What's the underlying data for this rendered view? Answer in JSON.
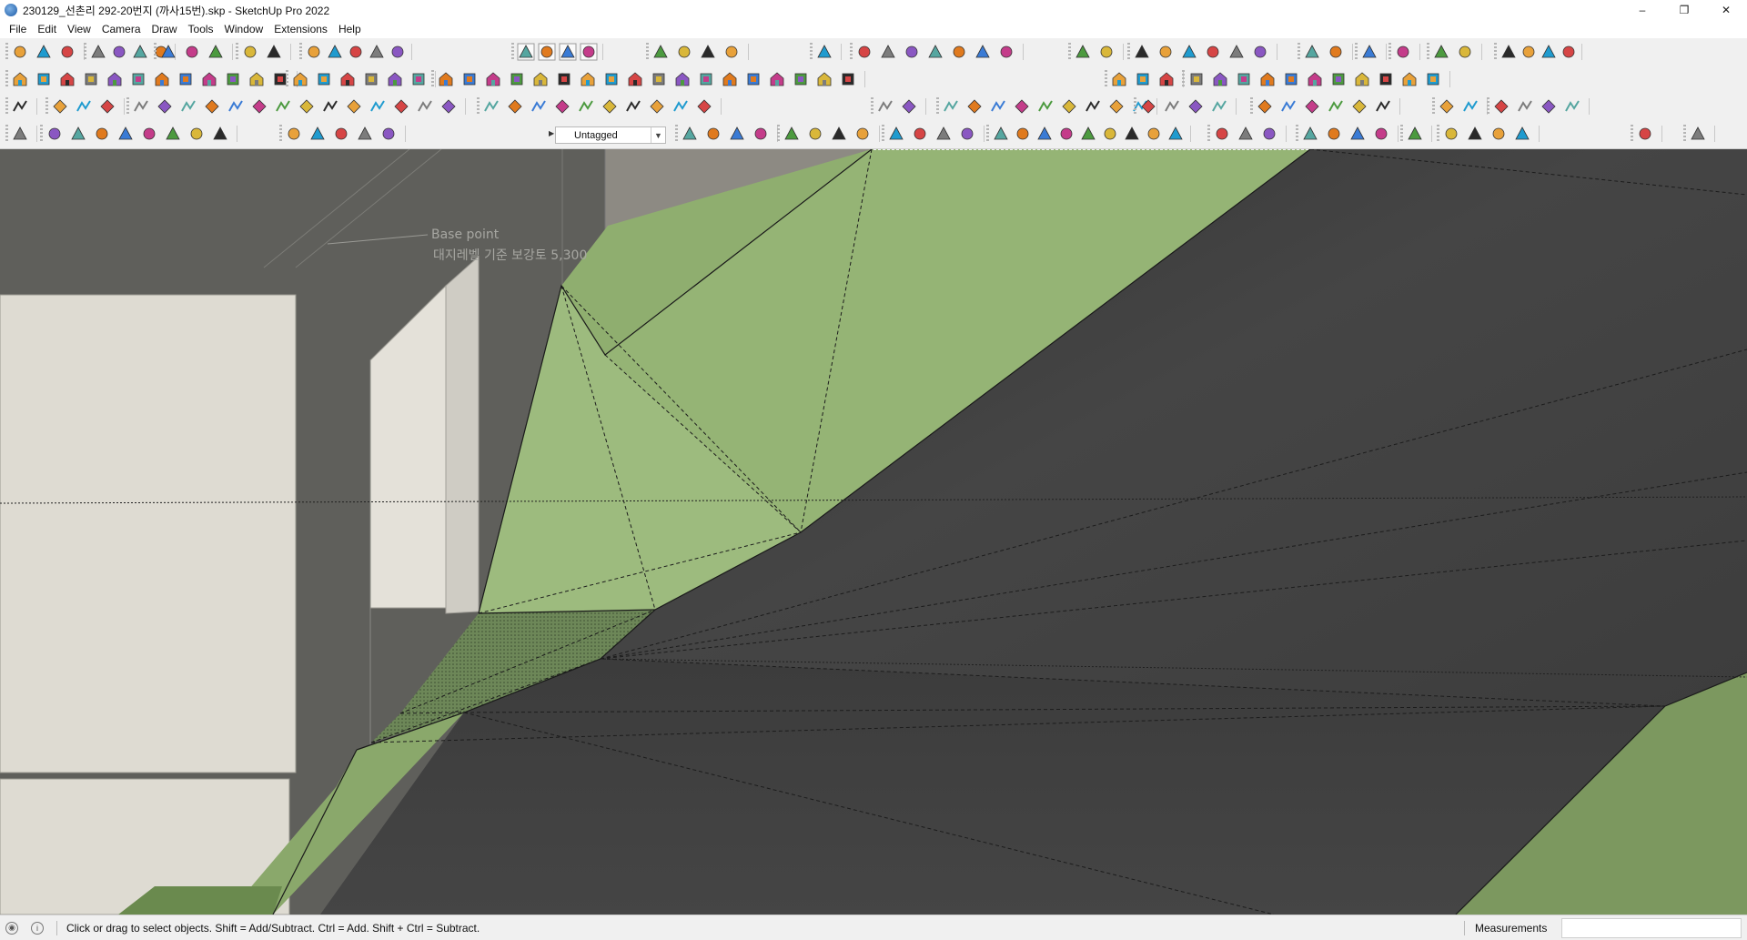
{
  "window": {
    "title": "230129_선촌리 292-20번지 (까사15번).skp - SketchUp Pro 2022",
    "minimize_glyph": "–",
    "restore_glyph": "❐",
    "close_glyph": "✕"
  },
  "menu": [
    "File",
    "Edit",
    "View",
    "Camera",
    "Draw",
    "Tools",
    "Window",
    "Extensions",
    "Help"
  ],
  "toolbar": {
    "tag_selector": {
      "value": "Untagged"
    },
    "icon_names": [
      "large-tool-set-icon",
      "select-icon",
      "eraser-icon",
      "paint-bucket-icon",
      "orbit-icon",
      "pan-icon",
      "zoom-icon",
      "zoom-extents-icon",
      "push-pull-icon",
      "move-icon",
      "rotate-icon",
      "scale-icon",
      "offset-icon",
      "line-icon",
      "arc-icon",
      "circle-icon",
      "polygon-icon",
      "rectangle-icon",
      "tape-measure-icon",
      "protractor-icon",
      "text-icon",
      "section-plane-icon",
      "component-icon",
      "group-icon",
      "warehouse-icon",
      "extension-warehouse-icon",
      "model-info-icon",
      "layout-icon",
      "sandbox-icon",
      "solid-tools-icon",
      "style-icon",
      "view-iso-icon",
      "view-top-icon",
      "view-front-icon",
      "fredoscale-icon",
      "curviloft-icon"
    ]
  },
  "viewport": {
    "base_point_label": "Base point",
    "annotation_label": "대지레벨 기준 보강토 5,300",
    "colors": {
      "background_wall": "#5f5f5b",
      "terrain_green": "#8fae6f",
      "terrain_dark": "#3d3d3d",
      "white_panel": "#dedbd2"
    }
  },
  "status": {
    "message": "Click or drag to select objects. Shift = Add/Subtract. Ctrl = Add. Shift + Ctrl = Subtract.",
    "measurements_label": "Measurements",
    "measurements_value": "",
    "geo_icon": "geolocation-icon",
    "info_icon": "info-icon"
  }
}
